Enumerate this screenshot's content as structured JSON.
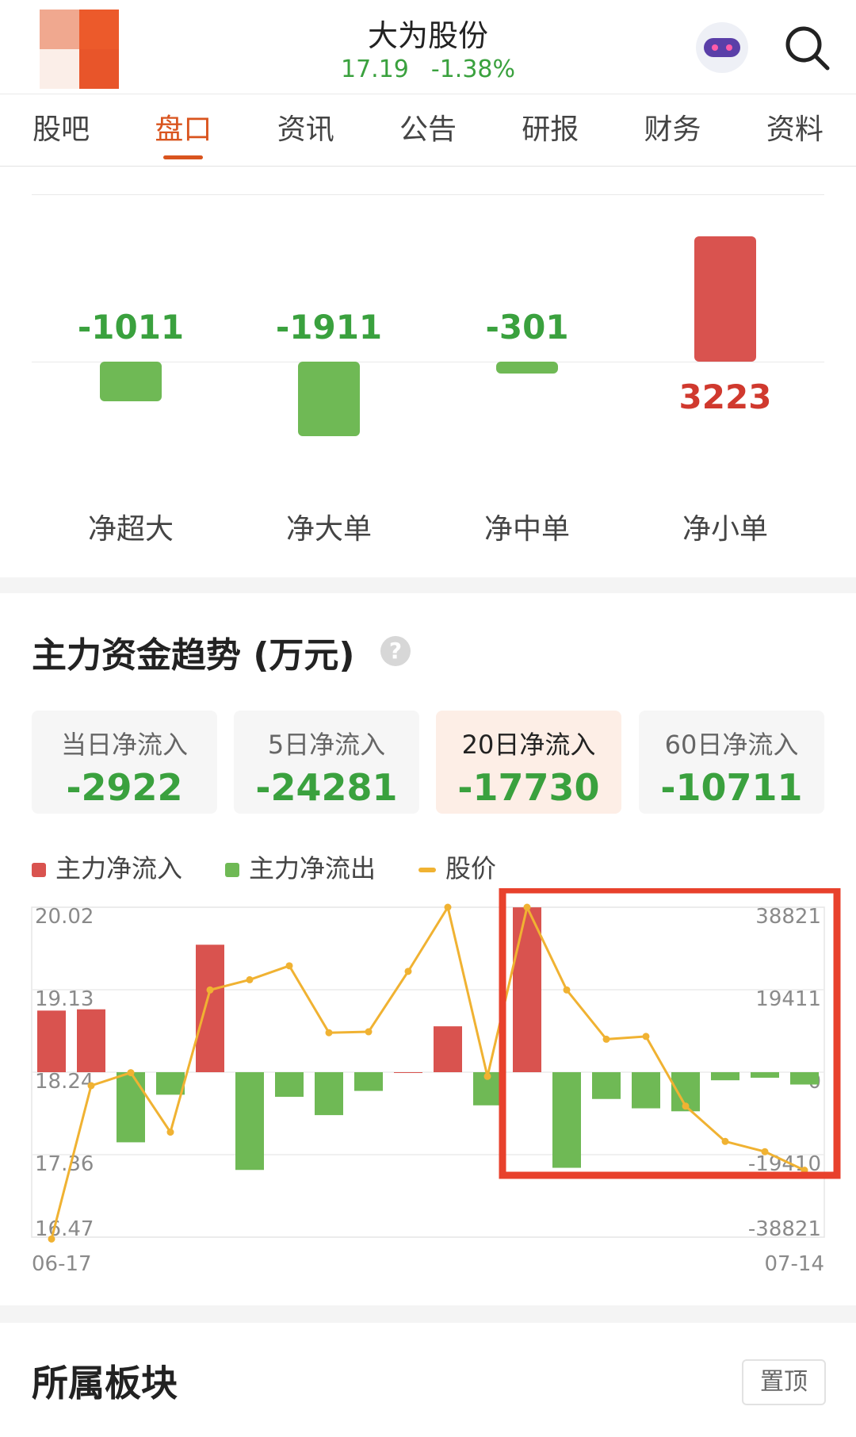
{
  "header": {
    "stock_name": "大为股份",
    "price": "17.19",
    "change_pct": "-1.38%"
  },
  "tabs": [
    "股吧",
    "盘口",
    "资讯",
    "公告",
    "研报",
    "财务",
    "资料"
  ],
  "active_tab": "盘口",
  "net_flow": {
    "items": [
      {
        "label": "净超大",
        "value": "-1011"
      },
      {
        "label": "净大单",
        "value": "-1911"
      },
      {
        "label": "净中单",
        "value": "-301"
      },
      {
        "label": "净小单",
        "value": "3223"
      }
    ]
  },
  "trend": {
    "title": "主力资金趋势 (万元)",
    "help": "?",
    "periods": [
      {
        "label": "当日净流入",
        "value": "-2922"
      },
      {
        "label": "5日净流入",
        "value": "-24281"
      },
      {
        "label": "20日净流入",
        "value": "-17730"
      },
      {
        "label": "60日净流入",
        "value": "-10711"
      }
    ],
    "active_period": "20日净流入"
  },
  "chart_data": {
    "type": "bar",
    "legend": [
      "主力净流入",
      "主力净流出",
      "股价"
    ],
    "x_start": "06-17",
    "x_end": "07-14",
    "left_axis_ticks": [
      "20.02",
      "19.13",
      "18.24",
      "17.36",
      "16.47"
    ],
    "right_axis_ticks": [
      "38821",
      "19411",
      "0",
      "-19410",
      "-38821"
    ],
    "left_ylim": [
      16.47,
      20.02
    ],
    "right_ylim": [
      -38821,
      38821
    ],
    "series": [
      {
        "name": "主力净流入 / 主力净流出",
        "values": [
          14500,
          14800,
          -16500,
          -5300,
          30000,
          -23000,
          -5800,
          -10100,
          -4400,
          0,
          10800,
          -7800,
          38800,
          -22500,
          -6300,
          -8500,
          -9200,
          -1900,
          -1300,
          -2900
        ]
      },
      {
        "name": "股价",
        "values": [
          16.45,
          18.1,
          18.24,
          17.6,
          19.13,
          19.24,
          19.39,
          18.67,
          18.68,
          19.33,
          20.02,
          18.2,
          20.02,
          19.13,
          18.6,
          18.63,
          17.88,
          17.5,
          17.39,
          17.19
        ]
      }
    ],
    "colors": {
      "inflow": "#d9534f",
      "outflow": "#6fb955",
      "price": "#f0b232"
    }
  },
  "sector": {
    "title": "所属板块",
    "pin_label": "置顶"
  }
}
